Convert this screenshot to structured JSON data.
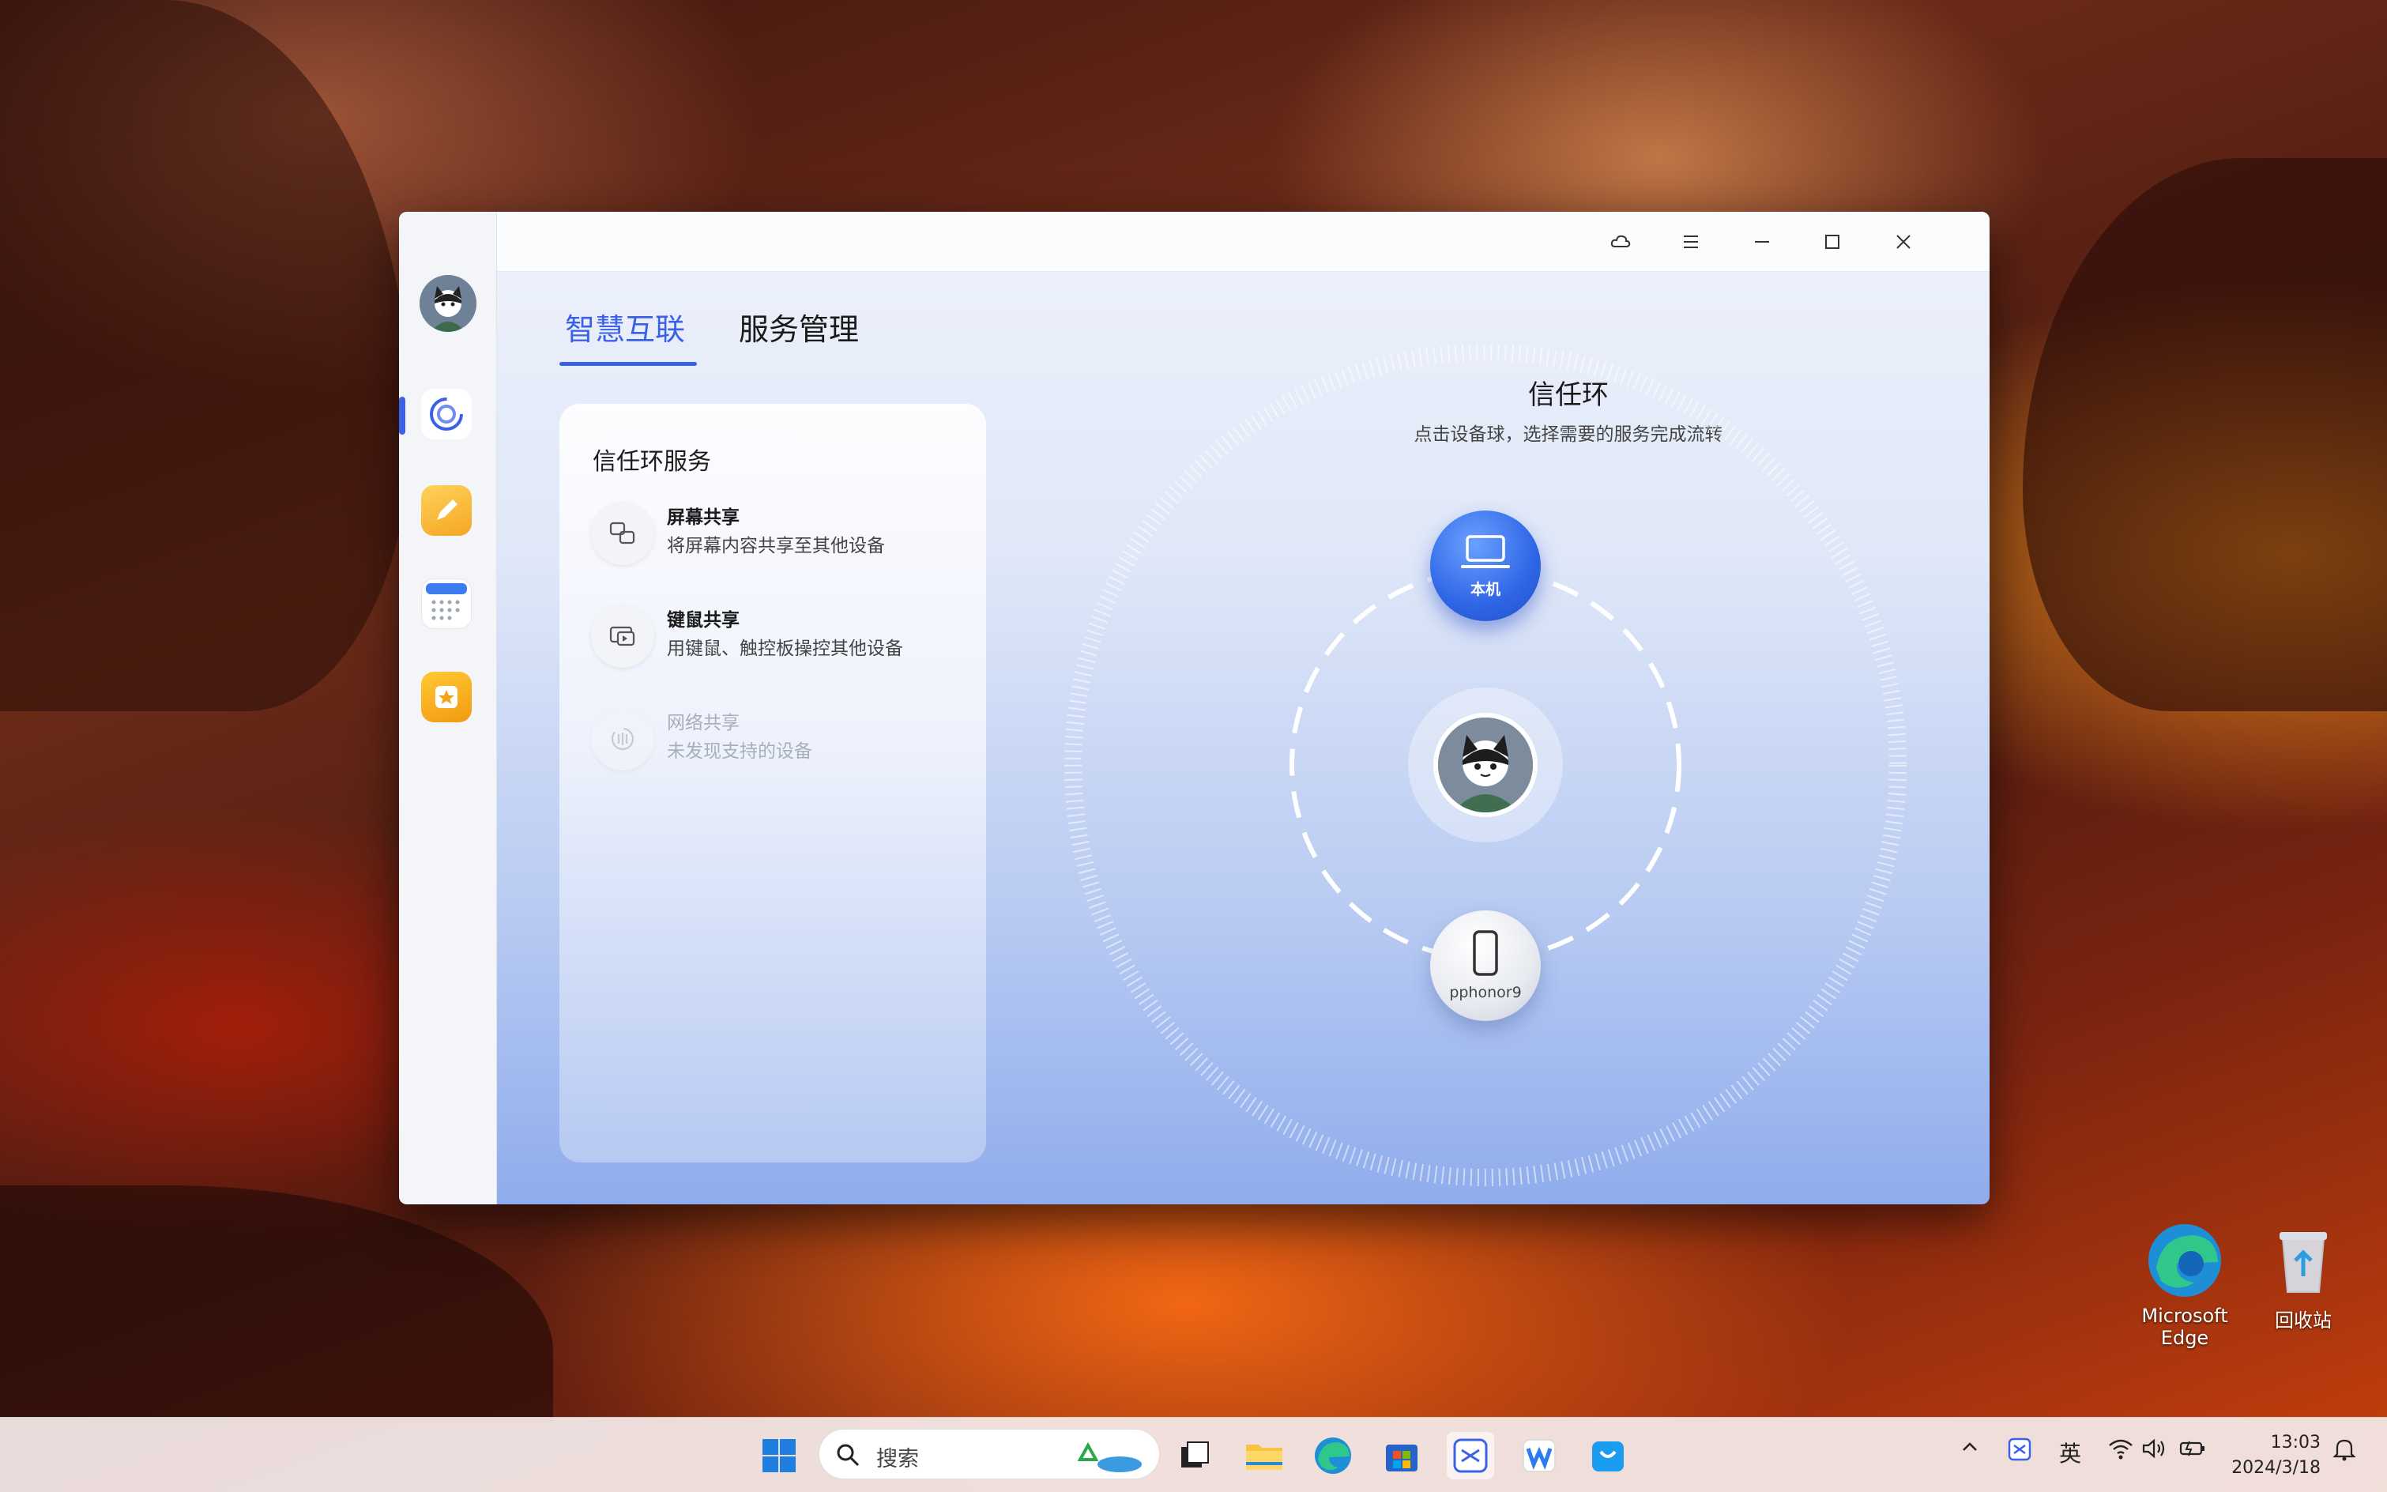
{
  "window": {
    "tabs": [
      {
        "label": "智慧互联",
        "active": true
      },
      {
        "label": "服务管理",
        "active": false
      }
    ],
    "titlebar_icons": [
      "cloud-icon",
      "menu-icon",
      "minimize-icon",
      "maximize-icon",
      "close-icon"
    ]
  },
  "sidebar": {
    "items": [
      {
        "name": "smart-connect",
        "icon": "ring-icon",
        "active": true
      },
      {
        "name": "notes",
        "icon": "pencil-icon"
      },
      {
        "name": "calendar",
        "icon": "calendar-icon"
      },
      {
        "name": "favorites",
        "icon": "star-icon"
      }
    ]
  },
  "services": {
    "title": "信任环服务",
    "items": [
      {
        "name": "屏幕共享",
        "desc": "将屏幕内容共享至其他设备",
        "icon": "screen-share-icon",
        "enabled": true
      },
      {
        "name": "键鼠共享",
        "desc": "用键鼠、触控板操控其他设备",
        "icon": "keyboard-mouse-icon",
        "enabled": true
      },
      {
        "name": "网络共享",
        "desc": "未发现支持的设备",
        "icon": "network-share-icon",
        "enabled": false
      }
    ]
  },
  "trust_ring": {
    "title": "信任环",
    "subtitle": "点击设备球，选择需要的服务完成流转",
    "devices": [
      {
        "label": "本机",
        "icon": "laptop-icon"
      },
      {
        "label": "pphonor9",
        "icon": "phone-icon"
      }
    ]
  },
  "desktop": {
    "icons": [
      {
        "label": "Microsoft Edge",
        "icon": "edge-icon"
      },
      {
        "label": "回收站",
        "icon": "recycle-bin-icon"
      }
    ]
  },
  "taskbar": {
    "search_placeholder": "搜索",
    "ime": "英",
    "time": "13:03",
    "date": "2024/3/18"
  },
  "colors": {
    "accent": "#3b62e6",
    "window_gradient_top": "#eef2fa",
    "window_gradient_bottom": "#8facec"
  }
}
